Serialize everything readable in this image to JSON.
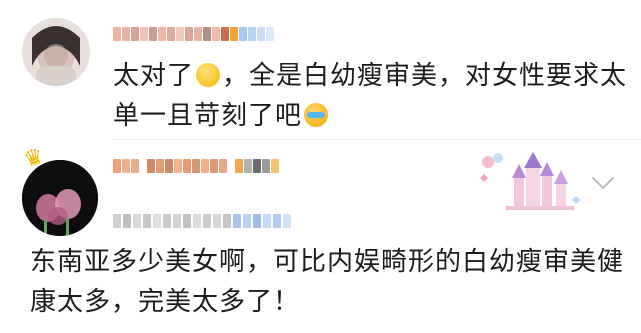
{
  "comments": [
    {
      "text": "太对了🙄，全是白幼瘦审美，对女性要求太单一且苛刻了吧😭",
      "text_before_emoji1": "太对了",
      "text_mid": "，全是白幼瘦审美，对女性要求太单一且苛刻了吧",
      "emojis": [
        "eye-roll-emoji",
        "crying-emoji"
      ]
    },
    {
      "text": "东南亚多少美女啊，可比内娱畸形的白幼瘦审美健康太多，完美太多了！",
      "line1": "东南亚多少美女啊，可比内娱畸形的白幼瘦审美健",
      "line2": "康太多，完美太多了！"
    }
  ],
  "colors": {
    "text": "#1c1c1c",
    "divider": "#eeeeee",
    "chevron": "#bbbbbb",
    "crown": "#f6b400"
  },
  "icons": [
    "crown-icon",
    "chevron-down-icon",
    "castle-decoration-icon"
  ]
}
